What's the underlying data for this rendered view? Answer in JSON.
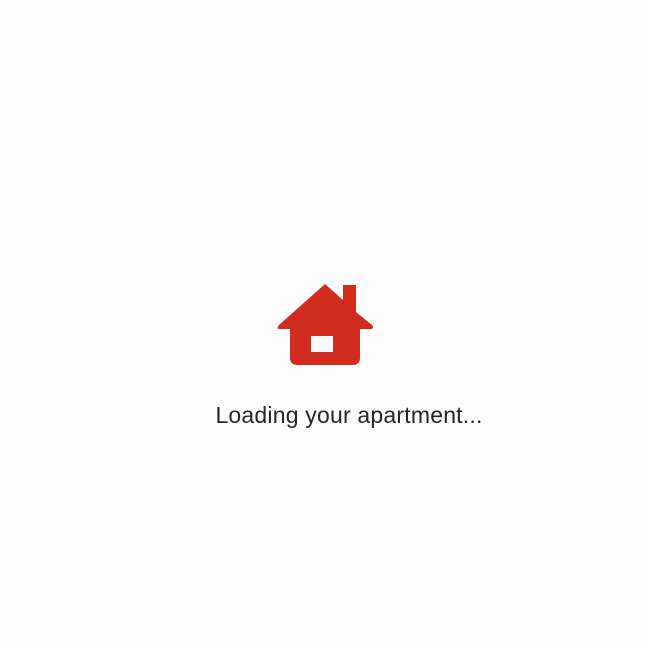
{
  "loader": {
    "icon": "house-icon",
    "icon_color": "#d12c20",
    "message": "Loading your apartment..."
  }
}
